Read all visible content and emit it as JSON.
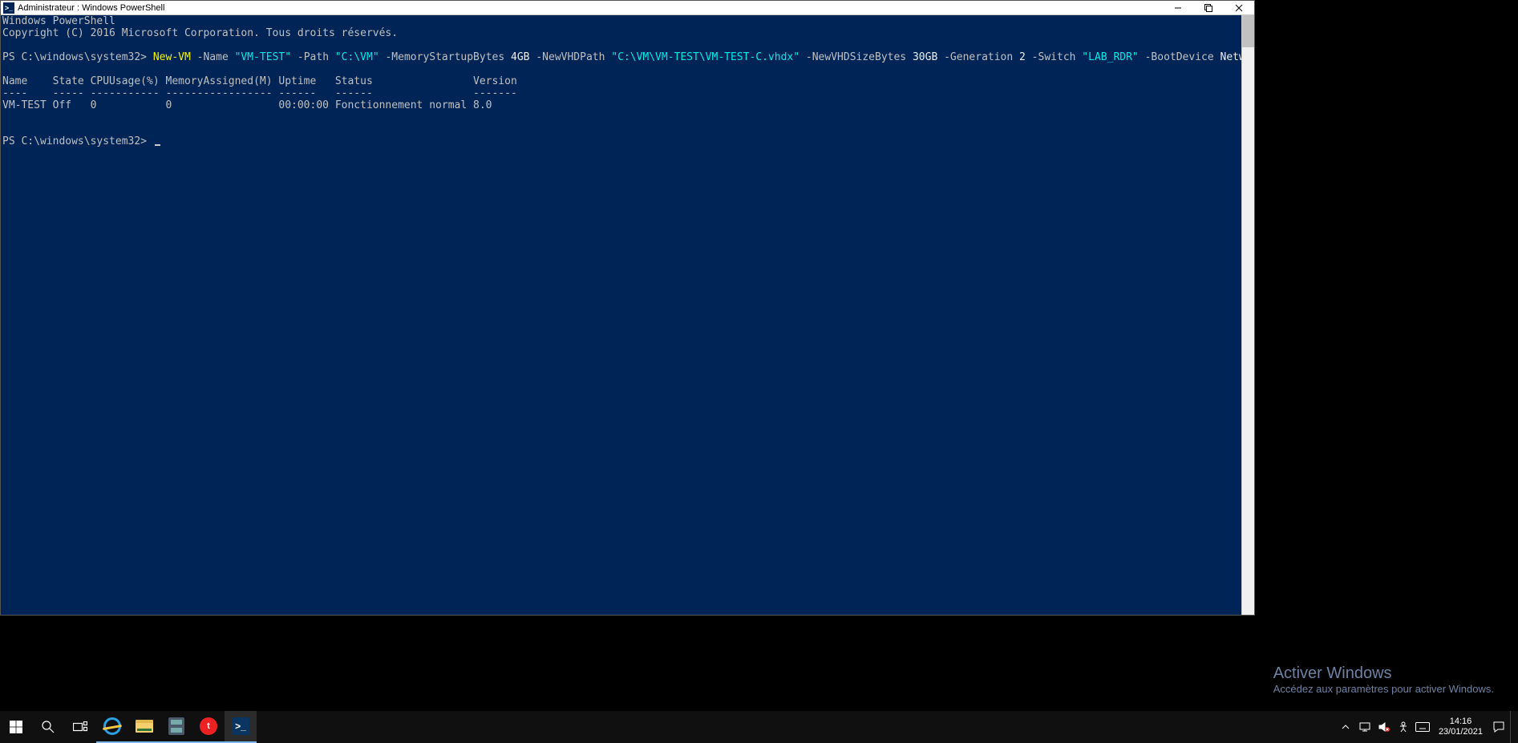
{
  "window": {
    "title": "Administrateur : Windows PowerShell"
  },
  "terminal": {
    "banner1": "Windows PowerShell",
    "banner2": "Copyright (C) 2016 Microsoft Corporation. Tous droits réservés.",
    "blank": "",
    "prompt1": "PS C:\\windows\\system32> ",
    "cmd": {
      "p1_cmd": "New-VM",
      "p1_flag_name": " -Name",
      "p1_val_name": " \"VM-TEST\"",
      "p1_flag_path": " -Path",
      "p1_val_path": " \"C:\\VM\"",
      "p1_flag_mem": " -MemoryStartupBytes",
      "p1_val_mem": " 4GB",
      "p1_flag_vhd": " -NewVHDPath",
      "p1_val_vhd": " \"C:\\VM\\VM-TEST\\VM-TEST-C.vhdx\"",
      "p1_flag_size": " -NewVHDSizeBytes",
      "p1_val_size": " 30GB",
      "p1_flag_gen": " -Generation",
      "p1_val_gen": " 2",
      "p1_flag_sw": " -Switch",
      "p1_val_sw": " \"LAB_RDR\"",
      "p1_flag_boot": " -BootDevice",
      "p1_val_boot": " NetworkAdapter"
    },
    "header": "Name    State CPUUsage(%) MemoryAssigned(M) Uptime   Status                Version",
    "divider": "----    ----- ----------- ----------------- ------   ------                -------",
    "row": "VM-TEST Off   0           0                 00:00:00 Fonctionnement normal 8.0",
    "prompt2": "PS C:\\windows\\system32> "
  },
  "watermark": {
    "title": "Activer Windows",
    "sub": "Accédez aux paramètres pour activer Windows."
  },
  "taskbar": {
    "time": "14:16",
    "date": "23/01/2021"
  }
}
